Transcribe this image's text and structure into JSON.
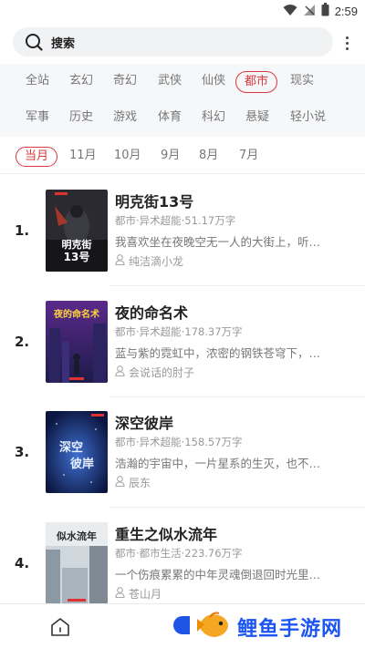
{
  "status_bar": {
    "time": "2:59"
  },
  "search": {
    "label": "搜索"
  },
  "categories": [
    {
      "label": "全站",
      "selected": false
    },
    {
      "label": "玄幻",
      "selected": false
    },
    {
      "label": "奇幻",
      "selected": false
    },
    {
      "label": "武侠",
      "selected": false
    },
    {
      "label": "仙侠",
      "selected": false
    },
    {
      "label": "都市",
      "selected": true
    },
    {
      "label": "现实",
      "selected": false
    },
    {
      "label": "军事",
      "selected": false
    },
    {
      "label": "历史",
      "selected": false
    },
    {
      "label": "游戏",
      "selected": false
    },
    {
      "label": "体育",
      "selected": false
    },
    {
      "label": "科幻",
      "selected": false
    },
    {
      "label": "悬疑",
      "selected": false
    },
    {
      "label": "轻小说",
      "selected": false
    }
  ],
  "months": [
    {
      "label": "当月",
      "selected": true
    },
    {
      "label": "11月",
      "selected": false
    },
    {
      "label": "10月",
      "selected": false
    },
    {
      "label": "9月",
      "selected": false
    },
    {
      "label": "8月",
      "selected": false
    },
    {
      "label": "7月",
      "selected": false
    }
  ],
  "books": [
    {
      "rank": "1.",
      "title": "明克街13号",
      "meta": "都市·异术超能·51.17万字",
      "desc": "我喜欢坐在夜晚空无一人的大街上，听…",
      "author": "纯洁滴小龙"
    },
    {
      "rank": "2.",
      "title": "夜的命名术",
      "meta": "都市·异术超能·178.37万字",
      "desc": "蓝与紫的霓虹中，浓密的钢铁苍穹下，…",
      "author": "会说话的肘子"
    },
    {
      "rank": "3.",
      "title": "深空彼岸",
      "meta": "都市·异术超能·158.57万字",
      "desc": "浩瀚的宇宙中，一片星系的生灭，也不…",
      "author": "辰东"
    },
    {
      "rank": "4.",
      "title": "重生之似水流年",
      "meta": "都市·都市生活·223.76万字",
      "desc": "一个伤痕累累的中年灵魂倒退回时光里…",
      "author": "苍山月"
    }
  ],
  "watermark": {
    "text": "鲤鱼手游网"
  },
  "colors": {
    "accent": "#d8383e",
    "brand_blue": "#1d55f0"
  },
  "icons": {
    "wifi": "wifi-icon",
    "signal": "signal-icon",
    "battery": "battery-icon",
    "search": "search-icon",
    "more": "more-vertical-icon",
    "author": "user-icon",
    "home": "home-icon",
    "fish": "fish-logo-icon"
  }
}
